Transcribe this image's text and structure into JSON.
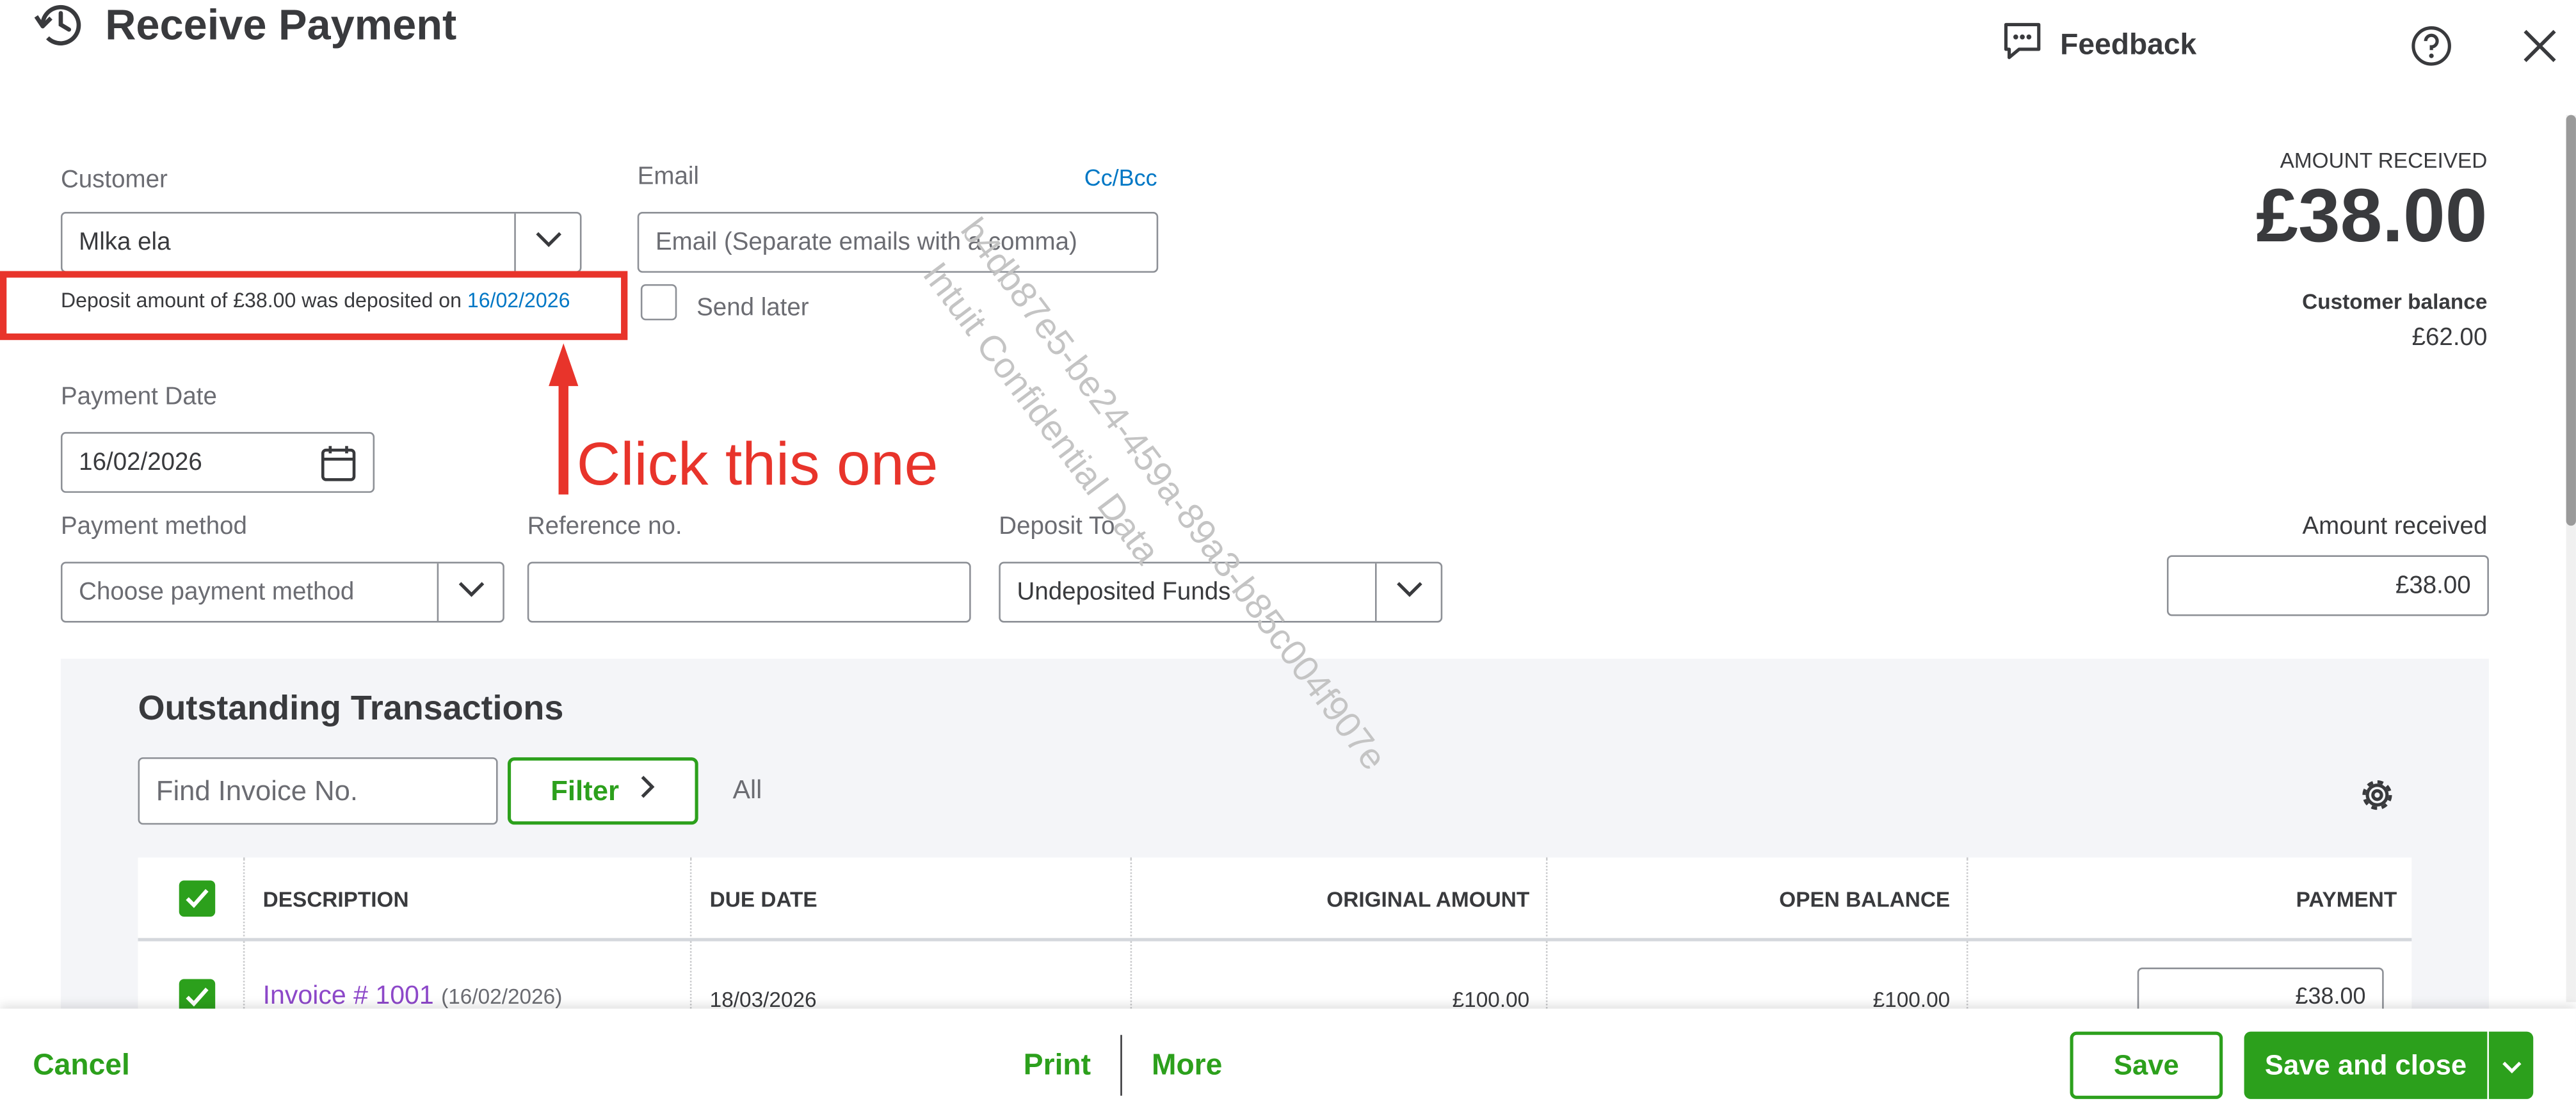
{
  "header": {
    "title": "Receive Payment",
    "feedback_label": "Feedback"
  },
  "customer": {
    "label": "Customer",
    "value": "Mlka ela",
    "deposit_note_prefix": "Deposit amount of £38.00 was deposited on",
    "deposit_note_link": "16/02/2026"
  },
  "email": {
    "label": "Email",
    "cc_bcc": "Cc/Bcc",
    "placeholder": "Email (Separate emails with a comma)",
    "send_later_label": "Send later"
  },
  "summary": {
    "amount_received_label": "AMOUNT RECEIVED",
    "amount_received_value": "£38.00",
    "customer_balance_label": "Customer balance",
    "customer_balance_value": "£62.00"
  },
  "payment_date": {
    "label": "Payment Date",
    "value": "16/02/2026"
  },
  "annotation": {
    "text": "Click this one",
    "color": "#e8342b"
  },
  "payment_method": {
    "label": "Payment method",
    "placeholder": "Choose payment method"
  },
  "reference": {
    "label": "Reference no.",
    "value": ""
  },
  "deposit_to": {
    "label": "Deposit To",
    "value": "Undeposited Funds"
  },
  "amount_received_field": {
    "label": "Amount received",
    "value": "£38.00"
  },
  "watermark": {
    "line1": "b4db87e5-be24-459a-89a3-b85c004f907e",
    "line2": "Intuit Confidential Data"
  },
  "outstanding": {
    "title": "Outstanding Transactions",
    "search_placeholder": "Find Invoice No.",
    "filter_label": "Filter",
    "all_label": "All",
    "columns": [
      "DESCRIPTION",
      "DUE DATE",
      "ORIGINAL AMOUNT",
      "OPEN BALANCE",
      "PAYMENT"
    ],
    "rows": [
      {
        "invoice": "Invoice # 1001",
        "invoice_date": "(16/02/2026)",
        "due_date": "18/03/2026",
        "original_amount": "£100.00",
        "open_balance": "£100.00",
        "payment": "£38.00"
      }
    ]
  },
  "footer": {
    "cancel": "Cancel",
    "print": "Print",
    "more": "More",
    "save": "Save",
    "save_close": "Save and close"
  },
  "colors": {
    "accent": "#2ca01c",
    "link": "#0077c5",
    "invoice_link": "#8d48c9",
    "annotation": "#e8342b"
  }
}
